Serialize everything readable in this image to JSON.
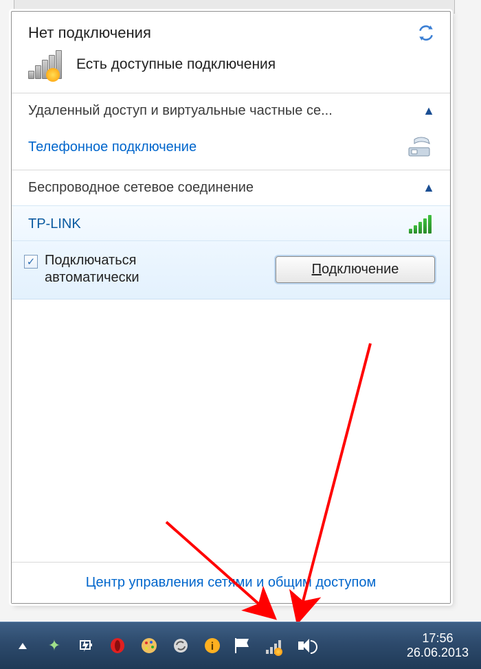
{
  "header": {
    "title": "Нет подключения"
  },
  "status": {
    "text": "Есть доступные подключения"
  },
  "groups": {
    "vpn": {
      "label": "Удаленный доступ и виртуальные частные се...",
      "dial_label": "Телефонное подключение"
    },
    "wifi": {
      "label": "Беспроводное сетевое соединение"
    }
  },
  "network": {
    "name": "TP-LINK",
    "auto_label_line1": "Подключаться",
    "auto_label_line2": "автоматически",
    "auto_checked": true,
    "connect_btn_prefix": "П",
    "connect_btn_rest": "одключение"
  },
  "footer": {
    "link": "Центр управления сетями и общим доступом"
  },
  "taskbar": {
    "time": "17:56",
    "date": "26.06.2013"
  }
}
